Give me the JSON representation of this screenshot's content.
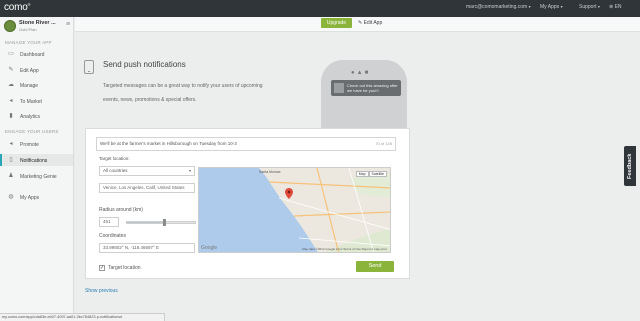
{
  "topbar": {
    "logo": "como",
    "logo_mark": "®",
    "account_email": "marc@comomarketing.com",
    "my_apps": "My Apps",
    "support": "Support",
    "language": "EN"
  },
  "sidebar": {
    "app_name": "Stone River ...",
    "app_plan": "Gold Plan",
    "sections": [
      {
        "title": "MANAGE YOUR APP"
      },
      {
        "title": "ENGAGE YOUR USERS"
      }
    ],
    "items": [
      {
        "label": "Dashboard",
        "icon": "dashboard-icon"
      },
      {
        "label": "Edit App",
        "icon": "pencil-icon"
      },
      {
        "label": "Manage",
        "icon": "cloud-icon"
      },
      {
        "label": "To Market",
        "icon": "megaphone-icon"
      },
      {
        "label": "Analytics",
        "icon": "chart-icon"
      },
      {
        "label": "Promote",
        "icon": "bullhorn-icon"
      },
      {
        "label": "Notifications",
        "icon": "phone-icon",
        "active": true
      },
      {
        "label": "Marketing Genie",
        "icon": "genie-icon"
      },
      {
        "label": "My Apps",
        "icon": "globe-icon"
      }
    ]
  },
  "header": {
    "upgrade_label": "Upgrade",
    "edit_app_label": "Edit App"
  },
  "main": {
    "title": "Send push notifications",
    "description": "Targeted messages can be a great way to notify your users of upcoming events, news, promotions & special offers.",
    "phone_os_icons": " ",
    "phone_preview_text": "Check out this amazing offer we have for you!!!"
  },
  "form": {
    "message": "We'll be at the farmer's market in Hillsborough on Tuesday from 10-3",
    "char_count": "70 of 145",
    "target_location_label": "Target location:",
    "country_value": "All countries",
    "address_value": "Venice, Los Angeles, Calif, United States",
    "radius_label": "Radius around (km)",
    "radius_value": "451",
    "radius_fraction": 0.55,
    "coordinates_label": "Coordinates",
    "coordinates_value": "33.99802° N, -118.46697° E",
    "target_location_checkbox": "Target location",
    "target_location_checked": true,
    "send_label": "Send",
    "show_previous_label": "Show previous"
  },
  "map": {
    "map_btn": "Map",
    "satellite_btn": "Satellite",
    "copyright": "Map data ©2014 Google  2 km  Terms of Use  Report a map error",
    "google": "Google",
    "labels": {
      "santa_monica": "Santa Monica"
    }
  },
  "feedback_label": "Feedback",
  "status_url": "my.como.com/app/c4a83e-eb07-4097-aa01-3bc784823-p-notifications#"
}
